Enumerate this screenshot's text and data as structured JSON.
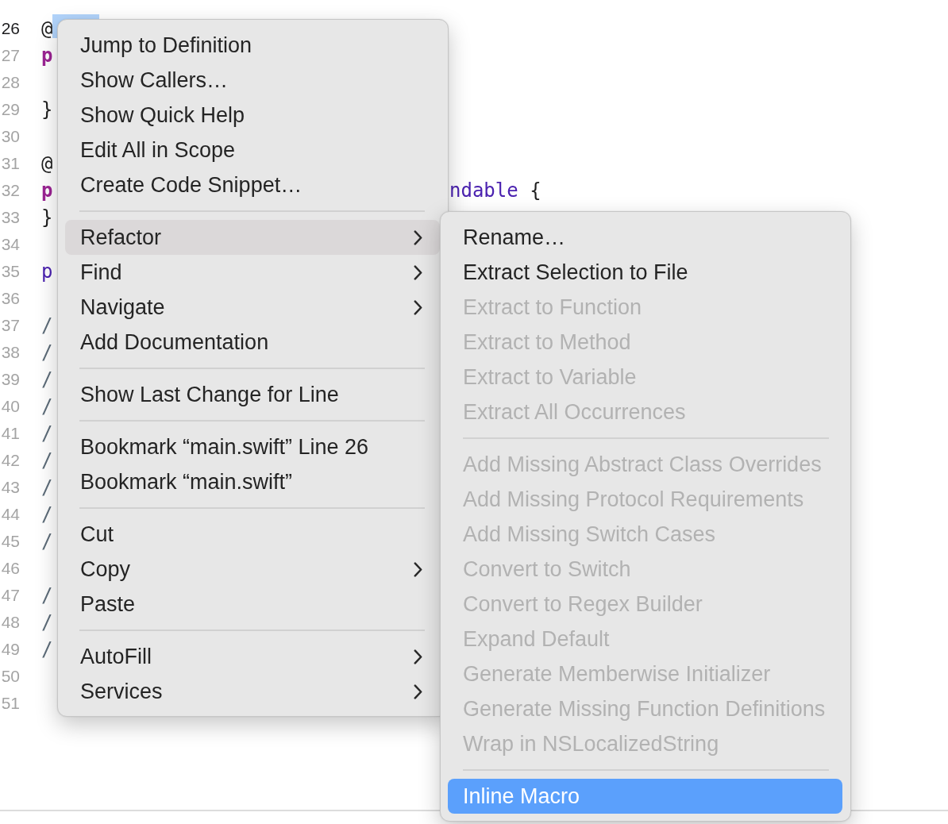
{
  "editor": {
    "lines": [
      {
        "number": "26",
        "current": true,
        "selection": true,
        "code": [
          {
            "text": "@",
            "kind": "plain"
          }
        ]
      },
      {
        "number": "27",
        "current": false,
        "selection": false,
        "code": [
          {
            "text": "p",
            "kind": "keyword"
          }
        ]
      },
      {
        "number": "28",
        "current": false,
        "selection": false
      },
      {
        "number": "29",
        "current": false,
        "selection": false,
        "code": [
          {
            "text": "}",
            "kind": "plain"
          }
        ]
      },
      {
        "number": "30",
        "current": false,
        "selection": false
      },
      {
        "number": "31",
        "current": false,
        "selection": false,
        "code": [
          {
            "text": "@",
            "kind": "plain"
          }
        ]
      },
      {
        "number": "32",
        "current": false,
        "selection": false,
        "code": [
          {
            "text": "p",
            "kind": "keyword"
          }
        ],
        "code_right": [
          {
            "text": "ndable",
            "kind": "type"
          },
          {
            "text": " {",
            "kind": "plain"
          }
        ]
      },
      {
        "number": "33",
        "current": false,
        "selection": false,
        "code": [
          {
            "text": "}",
            "kind": "plain"
          }
        ]
      },
      {
        "number": "34",
        "current": false,
        "selection": false
      },
      {
        "number": "35",
        "current": false,
        "selection": false,
        "code": [
          {
            "text": "p",
            "kind": "type"
          }
        ]
      },
      {
        "number": "36",
        "current": false,
        "selection": false
      },
      {
        "number": "37",
        "current": false,
        "selection": false,
        "code": [
          {
            "text": "/",
            "kind": "comment"
          }
        ]
      },
      {
        "number": "38",
        "current": false,
        "selection": false,
        "code": [
          {
            "text": "/",
            "kind": "comment"
          }
        ]
      },
      {
        "number": "39",
        "current": false,
        "selection": false,
        "code": [
          {
            "text": "/",
            "kind": "comment"
          }
        ]
      },
      {
        "number": "40",
        "current": false,
        "selection": false,
        "code": [
          {
            "text": "/",
            "kind": "comment"
          }
        ]
      },
      {
        "number": "41",
        "current": false,
        "selection": false,
        "code": [
          {
            "text": "/",
            "kind": "comment"
          }
        ]
      },
      {
        "number": "42",
        "current": false,
        "selection": false,
        "code": [
          {
            "text": "/",
            "kind": "comment"
          }
        ]
      },
      {
        "number": "43",
        "current": false,
        "selection": false,
        "code": [
          {
            "text": "/",
            "kind": "comment"
          }
        ]
      },
      {
        "number": "44",
        "current": false,
        "selection": false,
        "code": [
          {
            "text": "/",
            "kind": "comment"
          }
        ]
      },
      {
        "number": "45",
        "current": false,
        "selection": false,
        "code": [
          {
            "text": "/",
            "kind": "comment"
          }
        ]
      },
      {
        "number": "46",
        "current": false,
        "selection": false
      },
      {
        "number": "47",
        "current": false,
        "selection": false,
        "code": [
          {
            "text": "/",
            "kind": "comment"
          }
        ]
      },
      {
        "number": "48",
        "current": false,
        "selection": false,
        "code": [
          {
            "text": "/",
            "kind": "comment"
          }
        ]
      },
      {
        "number": "49",
        "current": false,
        "selection": false,
        "code": [
          {
            "text": "/",
            "kind": "comment"
          }
        ]
      },
      {
        "number": "50",
        "current": false,
        "selection": false
      },
      {
        "number": "51",
        "current": false,
        "selection": false
      }
    ]
  },
  "context_menu": {
    "groups": [
      [
        {
          "label": "Jump to Definition",
          "selected": false,
          "submenu": false
        },
        {
          "label": "Show Callers…",
          "selected": false,
          "submenu": false
        },
        {
          "label": "Show Quick Help",
          "selected": false,
          "submenu": false
        },
        {
          "label": "Edit All in Scope",
          "selected": false,
          "submenu": false
        },
        {
          "label": "Create Code Snippet…",
          "selected": false,
          "submenu": false
        }
      ],
      [
        {
          "label": "Refactor",
          "selected": true,
          "submenu": true
        },
        {
          "label": "Find",
          "selected": false,
          "submenu": true
        },
        {
          "label": "Navigate",
          "selected": false,
          "submenu": true
        },
        {
          "label": "Add Documentation",
          "selected": false,
          "submenu": false
        }
      ],
      [
        {
          "label": "Show Last Change for Line",
          "selected": false,
          "submenu": false
        }
      ],
      [
        {
          "label": "Bookmark “main.swift” Line 26",
          "selected": false,
          "submenu": false
        },
        {
          "label": "Bookmark “main.swift”",
          "selected": false,
          "submenu": false
        }
      ],
      [
        {
          "label": "Cut",
          "selected": false,
          "submenu": false
        },
        {
          "label": "Copy",
          "selected": false,
          "submenu": true
        },
        {
          "label": "Paste",
          "selected": false,
          "submenu": false
        }
      ],
      [
        {
          "label": "AutoFill",
          "selected": false,
          "submenu": true
        },
        {
          "label": "Services",
          "selected": false,
          "submenu": true
        }
      ]
    ]
  },
  "refactor_submenu": {
    "groups": [
      [
        {
          "label": "Rename…",
          "selected": false,
          "disabled": false
        },
        {
          "label": "Extract Selection to File",
          "selected": false,
          "disabled": false
        },
        {
          "label": "Extract to Function",
          "selected": false,
          "disabled": true
        },
        {
          "label": "Extract to Method",
          "selected": false,
          "disabled": true
        },
        {
          "label": "Extract to Variable",
          "selected": false,
          "disabled": true
        },
        {
          "label": "Extract All Occurrences",
          "selected": false,
          "disabled": true
        }
      ],
      [
        {
          "label": "Add Missing Abstract Class Overrides",
          "selected": false,
          "disabled": true
        },
        {
          "label": "Add Missing Protocol Requirements",
          "selected": false,
          "disabled": true
        },
        {
          "label": "Add Missing Switch Cases",
          "selected": false,
          "disabled": true
        },
        {
          "label": "Convert to Switch",
          "selected": false,
          "disabled": true
        },
        {
          "label": "Convert to Regex Builder",
          "selected": false,
          "disabled": true
        },
        {
          "label": "Expand Default",
          "selected": false,
          "disabled": true
        },
        {
          "label": "Generate Memberwise Initializer",
          "selected": false,
          "disabled": true
        },
        {
          "label": "Generate Missing Function Definitions",
          "selected": false,
          "disabled": true
        },
        {
          "label": "Wrap in NSLocalizedString",
          "selected": false,
          "disabled": true
        }
      ],
      [
        {
          "label": "Inline Macro",
          "selected": true,
          "disabled": false
        }
      ]
    ]
  }
}
